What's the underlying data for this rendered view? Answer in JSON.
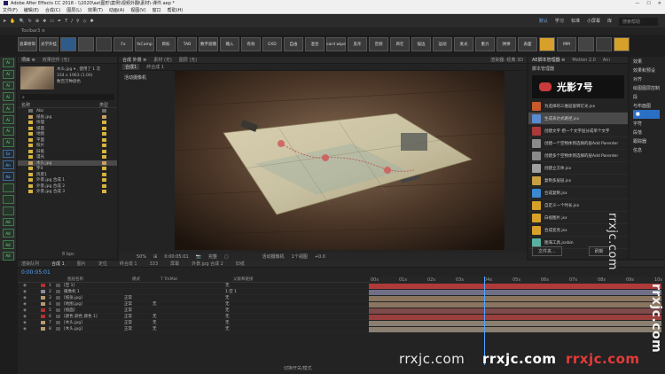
{
  "app": {
    "title": "Adobe After Effects CC 2018 - \\\\2020\\ae\\图形\\案例\\视频外翻\\素材\\-课件.aep *",
    "window_controls": [
      "—",
      "☐",
      "✕"
    ]
  },
  "menu": [
    "文件(F)",
    "编辑(E)",
    "合成(C)",
    "图层(L)",
    "效果(T)",
    "动画(A)",
    "视图(V)",
    "窗口",
    "帮助(H)"
  ],
  "toolbar": {
    "workspaces": [
      "默认",
      "学习",
      "标准",
      "小屏幕",
      "库"
    ],
    "search_placeholder": "搜索帮助"
  },
  "script_panel": {
    "label": "Toolbar3 ≡"
  },
  "plugins": [
    "遮罩修饰",
    "光学外挂",
    "",
    "",
    "",
    "Fx",
    "fxCamp",
    "目标",
    "TAB",
    "数字遮帽",
    "输入",
    "有效",
    "EXD",
    "自由",
    "混合",
    "card wipe",
    "反斥",
    "音频",
    "目在",
    "描边",
    "运动",
    "发光",
    "重力",
    "弹弹",
    "表面",
    "",
    "MM",
    "",
    "",
    ""
  ],
  "left_dock": [
    "Ai",
    "Ai",
    "Ai",
    "Ai",
    "Ai",
    "Ai",
    "Ai",
    "Ai",
    "Gr",
    "An",
    "Aa",
    "",
    "",
    "",
    "Ad",
    "Ad",
    "Ad",
    "Ad"
  ],
  "project": {
    "tabs": [
      "项目 ≡",
      "效果控件 (无)"
    ],
    "footage_name": "木头.jpg ▾ , 使用了 1 次",
    "footage_info": "334 x 1963 (1.00)",
    "footage_info2": "数百万种颜色",
    "search_placeholder": "",
    "columns": [
      "名称",
      "类型"
    ],
    "items": [
      {
        "name": "Abc",
        "color": "#6a6a6a"
      },
      {
        "name": "纸张.jpg",
        "color": "#c8a060"
      },
      {
        "name": "纹理",
        "color": "#d6b340"
      },
      {
        "name": "纸面",
        "color": "#d6b340"
      },
      {
        "name": "地图",
        "color": "#d6b340"
      },
      {
        "name": "平面",
        "color": "#d6b340"
      },
      {
        "name": "照片",
        "color": "#d6b340"
      },
      {
        "name": "旧纸",
        "color": "#d6b340"
      },
      {
        "name": "漫光",
        "color": "#d6b340"
      },
      {
        "name": "木头.jpg",
        "color": "#c8a060",
        "selected": true
      },
      {
        "name": "字4",
        "color": "#d6b340"
      },
      {
        "name": "风景1",
        "color": "#d6b340"
      },
      {
        "name": "外景.jpg 合成 1",
        "color": "#d6b340"
      },
      {
        "name": "外景.jpg 合成 2",
        "color": "#d6b340"
      },
      {
        "name": "外景.jpg 合成 3",
        "color": "#d6b340"
      }
    ],
    "bottom": "8 bpc"
  },
  "viewer": {
    "tabs": [
      "合成 外景 ≡",
      "素材 (无)",
      "图层 (无)"
    ],
    "breadcrumb": [
      "合成1",
      "终合成 1"
    ],
    "label": "活动摄像机",
    "renderer": "渲染器: 经典 3D",
    "zoom": "50%",
    "timecode": "0:00:05:01",
    "quality": "完整",
    "camera": "活动摄像机",
    "views": "1个视图",
    "exposure": "+0.0"
  },
  "right_script": {
    "tabs": [
      "AE脚本管理器 ≡",
      "Motion 2.0",
      "Ani"
    ],
    "section": "脚本管理器",
    "logo": "光影7号",
    "scripts": [
      "为选择的三维层旋转灯光.jsx",
      "生成表达式路径.jsx",
      "创建文字 把一个文字层分成单个文字",
      "创建一个空物体到选择的层Add Parenter",
      "创建多个空物体到选择的层Add Parenter",
      "创建立方体.jsx",
      "复制多层层.jsx",
      "合成复制.jsx",
      "自定义一个时长.jsx",
      "白视图片.jsx",
      "合成变亮.jsx",
      "图海工具.jsxbin"
    ],
    "buttons": [
      "文件夹...",
      "刷新"
    ]
  },
  "far_right": {
    "items": [
      "效果",
      "效果和预设",
      "对齐",
      "绘图图层控制",
      "段",
      "与布面图",
      "■",
      "字符",
      "段落",
      "跟踪器",
      "信息"
    ]
  },
  "timeline": {
    "tabs": [
      "渲染队列",
      "合成 1",
      "图片",
      "定位",
      "终合成 1",
      "333",
      "屏幕",
      "外景.jpg 合成 2",
      "旧纸"
    ],
    "timecode": "0:00:05:01",
    "columns": [
      "图层名称",
      "模式",
      "T TrkMat",
      "父级和链接"
    ],
    "ruler": [
      "00s",
      "01s",
      "02s",
      "03s",
      "04s",
      "05s",
      "06s",
      "07s",
      "08s",
      "09s",
      "10s"
    ],
    "layers": [
      {
        "num": "1",
        "name": "[空 1]",
        "mode": "",
        "trk": "",
        "parent": "无",
        "color": "#b03030",
        "bar": "#b03a3a"
      },
      {
        "num": "2",
        "name": "摄像机 1",
        "mode": "",
        "trk": "",
        "parent": "1.空 1",
        "color": "#8a8aa0",
        "bar": "#6f6f86"
      },
      {
        "num": "3",
        "name": "[纸张.jpg]",
        "mode": "正常",
        "trk": "",
        "parent": "无",
        "color": "#b79a70",
        "bar": "#8a7560"
      },
      {
        "num": "4",
        "name": "[地图.jpg]",
        "mode": "正常",
        "trk": "无",
        "parent": "无",
        "color": "#b79a70",
        "bar": "#8a7560"
      },
      {
        "num": "5",
        "name": "[纸面]",
        "mode": "正常",
        "trk": "",
        "parent": "无",
        "color": "#b03030",
        "bar": "#7e4a4a"
      },
      {
        "num": "6",
        "name": "[颜色 颜色 颜色 1]",
        "mode": "正常",
        "trk": "无",
        "parent": "无",
        "color": "#b03030",
        "bar": "#9a3e3e"
      },
      {
        "num": "7",
        "name": "[木头.jpg]",
        "mode": "正常",
        "trk": "无",
        "parent": "无",
        "color": "#b79a70",
        "bar": "#8a7f70"
      },
      {
        "num": "8",
        "name": "[木头.jpg]",
        "mode": "正常",
        "trk": "无",
        "parent": "无",
        "color": "#b79a70",
        "bar": "#8a7f70"
      }
    ],
    "footer": "切换开关/模式"
  },
  "watermarks": [
    "rrxjc.com",
    "rrxjc.com",
    "rrxjc.com",
    "rrxjc.com",
    "rrxjc.com"
  ]
}
